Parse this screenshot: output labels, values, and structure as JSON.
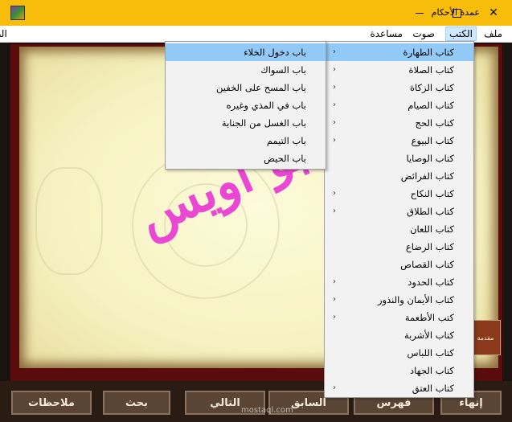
{
  "window": {
    "title": "عمدة الأحكام"
  },
  "menubar": {
    "items": [
      "ملف",
      "الكتب",
      "صوت",
      "مساعدة"
    ],
    "active_index": 1
  },
  "outside_fragment": "الب",
  "books_menu": [
    {
      "label": "كتاب الطهارة",
      "has_submenu": true,
      "highlighted": true
    },
    {
      "label": "كتاب الصلاة",
      "has_submenu": true
    },
    {
      "label": "كتاب الزكاة",
      "has_submenu": true
    },
    {
      "label": "كتاب الصيام",
      "has_submenu": true
    },
    {
      "label": "كتاب الحج",
      "has_submenu": true
    },
    {
      "label": "كتاب البيوع",
      "has_submenu": true
    },
    {
      "label": "كتاب الوصايا",
      "has_submenu": false
    },
    {
      "label": "كتاب الفرائض",
      "has_submenu": false
    },
    {
      "label": "كتاب النكاح",
      "has_submenu": true
    },
    {
      "label": "كتاب الطلاق",
      "has_submenu": true
    },
    {
      "label": "كتاب اللعان",
      "has_submenu": false
    },
    {
      "label": "كتاب الرضاع",
      "has_submenu": false
    },
    {
      "label": "كتاب القصاص",
      "has_submenu": false
    },
    {
      "label": "كتاب الحدود",
      "has_submenu": true
    },
    {
      "label": "كتاب الأيمان والنذور",
      "has_submenu": true
    },
    {
      "label": "كتب الأطعمة",
      "has_submenu": true
    },
    {
      "label": "كتاب الأشربة",
      "has_submenu": false
    },
    {
      "label": "كتاب اللباس",
      "has_submenu": false
    },
    {
      "label": "كتاب الجهاد",
      "has_submenu": false
    },
    {
      "label": "كتاب العتق",
      "has_submenu": true
    }
  ],
  "taharah_submenu": [
    {
      "label": "باب دخول الخلاء",
      "highlighted": true
    },
    {
      "label": "باب السواك"
    },
    {
      "label": "باب المسح على الخفين"
    },
    {
      "label": "باب في المذي وغيره"
    },
    {
      "label": "باب الغسل من الجنابة"
    },
    {
      "label": "باب التيمم"
    },
    {
      "label": "باب الحيض"
    }
  ],
  "watermark_text": "ابو أويس",
  "bottom_buttons": {
    "notes": "ملاحظات",
    "search": "بحث",
    "next": "التالي",
    "prev": "السابق",
    "index": "فهرس",
    "end": "إنهاء"
  },
  "footer_watermark": "mostaql.com",
  "side_badge": "مقدمة",
  "icons": {
    "chevron": "chevron-left-icon",
    "app": "app-logo-icon"
  },
  "colors": {
    "titlebar": "#f8bd0b",
    "highlight": "#91c9f7",
    "watermark": "#ea3ed4",
    "frame": "#5a0b0b"
  }
}
